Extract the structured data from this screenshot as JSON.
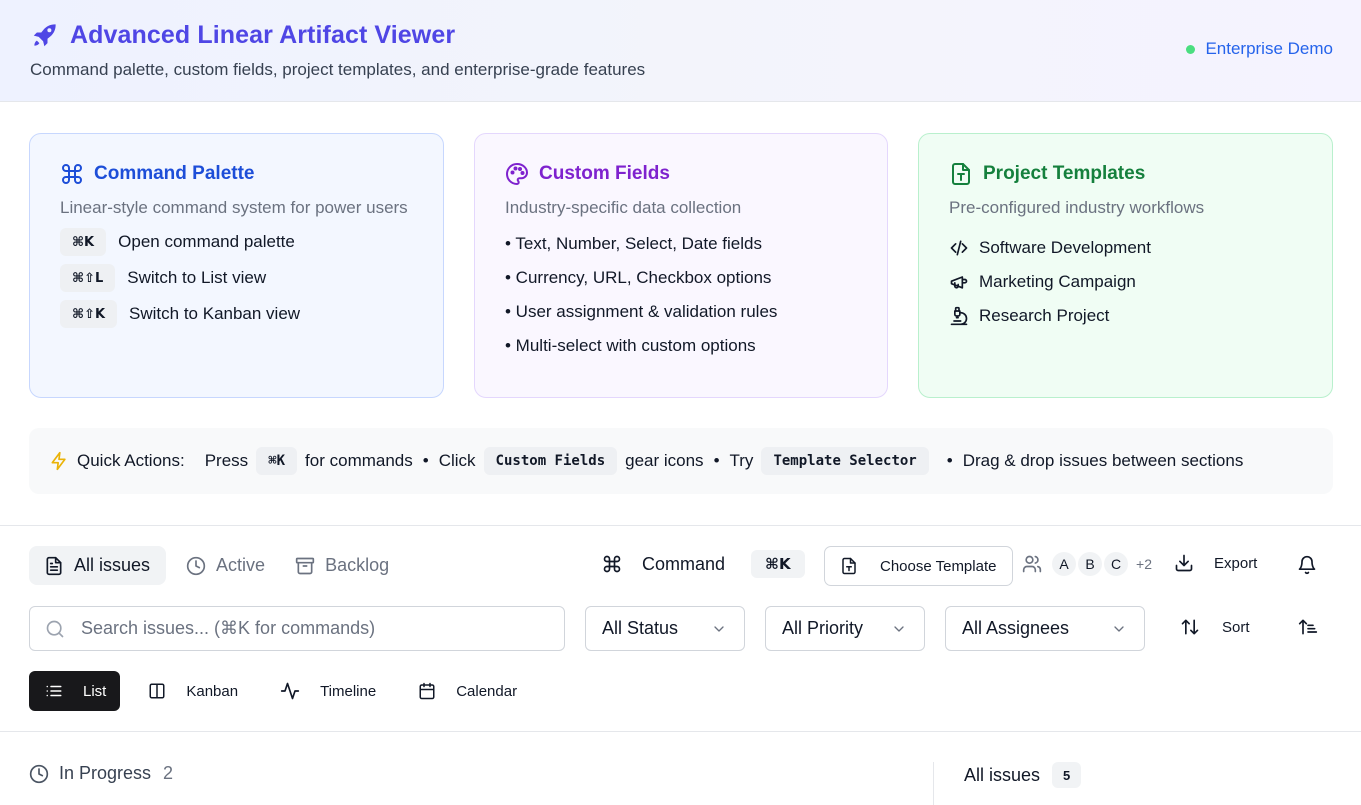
{
  "header": {
    "title": "Advanced Linear Artifact Viewer",
    "subtitle": "Command palette, custom fields, project templates, and enterprise-grade features",
    "badge": "Enterprise Demo",
    "icon": "rocket-icon"
  },
  "cards": {
    "command": {
      "title": "Command Palette",
      "description": "Linear-style command system for power users",
      "shortcuts": [
        {
          "keys": "⌘K",
          "label": "Open command palette"
        },
        {
          "keys": "⌘⇧L",
          "label": "Switch to List view"
        },
        {
          "keys": "⌘⇧K",
          "label": "Switch to Kanban view"
        }
      ]
    },
    "fields": {
      "title": "Custom Fields",
      "description": "Industry-specific data collection",
      "bullets": [
        "• Text, Number, Select, Date fields",
        "• Currency, URL, Checkbox options",
        "• User assignment & validation rules",
        "• Multi-select with custom options"
      ]
    },
    "templates": {
      "title": "Project Templates",
      "description": "Pre-configured industry workflows",
      "items": [
        "Software Development",
        "Marketing Campaign",
        "Research Project"
      ]
    }
  },
  "quick_actions": {
    "label": "Quick Actions:",
    "press": "Press",
    "press_key": "⌘K",
    "for_commands": "for commands",
    "click": "Click",
    "custom_fields": "Custom Fields",
    "gear_icons": "gear icons",
    "try": "Try",
    "template_selector": "Template Selector",
    "drag": "Drag & drop issues between sections",
    "separator": "•"
  },
  "toolbar": {
    "tabs": [
      "All issues",
      "Active",
      "Backlog"
    ],
    "command_label": "Command",
    "command_key": "⌘K",
    "template_button": "Choose Template",
    "avatars": [
      "A",
      "B",
      "C"
    ],
    "avatars_more": "+2",
    "export_label": "Export"
  },
  "filters": {
    "search_placeholder": "Search issues... (⌘K for commands)",
    "status": "All Status",
    "priority": "All Priority",
    "assignees": "All Assignees",
    "sort_label": "Sort"
  },
  "views": [
    "List",
    "Kanban",
    "Timeline",
    "Calendar"
  ],
  "active_view": "List",
  "groups": {
    "in_progress_label": "In Progress",
    "in_progress_count": "2",
    "sidebar_label": "All issues",
    "sidebar_count": "5"
  },
  "colors": {
    "accent": "#4f46e5",
    "blue": "#1d4ed8",
    "purple": "#7e22ce",
    "green": "#15803d",
    "status_dot": "#4ade80"
  }
}
